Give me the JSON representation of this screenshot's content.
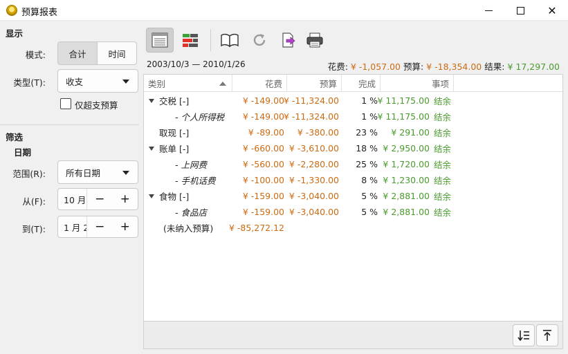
{
  "window": {
    "title": "预算报表"
  },
  "display": {
    "section_label": "显示",
    "mode_label": "模式:",
    "mode_options": [
      "合计",
      "时间"
    ],
    "type_label": "类型(T):",
    "type_value": "收支",
    "only_over_label": "仅超支预算"
  },
  "filter": {
    "section_label": "筛选",
    "date_label": "日期",
    "range_label": "范围(R):",
    "range_value": "所有日期",
    "from_label": "从(F):",
    "from_value": "10 月",
    "to_label": "到(T):",
    "to_value": "1 月 2",
    "minus": "−",
    "plus": "+"
  },
  "toolbar": {
    "icons": [
      "table-view-icon",
      "bar-chart-icon",
      "book-icon",
      "refresh-icon",
      "export-icon",
      "print-icon"
    ]
  },
  "report": {
    "date_range": "2003/10/3 — 2010/1/26",
    "spent_label": "花费:",
    "spent_value": "¥ -1,057.00",
    "budget_label": "预算:",
    "budget_value": "¥ -18,354.00",
    "result_label": "结果:",
    "result_value": "¥ 17,297.00"
  },
  "table": {
    "headers": {
      "category": "类别",
      "spent": "花费",
      "budget": "预算",
      "done": "完成",
      "item": "事项"
    },
    "rows": [
      {
        "category": "交税 [-]",
        "spent": "¥ -149.00",
        "budget": "¥ -11,324.00",
        "pct": "1 %",
        "remain": "¥ 11,175.00",
        "item": "结余"
      },
      {
        "category": "- 个人所得税",
        "spent": "¥ -149.00",
        "budget": "¥ -11,324.00",
        "pct": "1 %",
        "remain": "¥ 11,175.00",
        "item": "结余"
      },
      {
        "category": "取现 [-]",
        "spent": "¥ -89.00",
        "budget": "¥ -380.00",
        "pct": "23 %",
        "remain": "¥ 291.00",
        "item": "结余"
      },
      {
        "category": "账单 [-]",
        "spent": "¥ -660.00",
        "budget": "¥ -3,610.00",
        "pct": "18 %",
        "remain": "¥ 2,950.00",
        "item": "结余"
      },
      {
        "category": "- 上网费",
        "spent": "¥ -560.00",
        "budget": "¥ -2,280.00",
        "pct": "25 %",
        "remain": "¥ 1,720.00",
        "item": "结余"
      },
      {
        "category": "- 手机话费",
        "spent": "¥ -100.00",
        "budget": "¥ -1,330.00",
        "pct": "8 %",
        "remain": "¥ 1,230.00",
        "item": "结余"
      },
      {
        "category": "食物 [-]",
        "spent": "¥ -159.00",
        "budget": "¥ -3,040.00",
        "pct": "5 %",
        "remain": "¥ 2,881.00",
        "item": "结余"
      },
      {
        "category": "- 食品店",
        "spent": "¥ -159.00",
        "budget": "¥ -3,040.00",
        "pct": "5 %",
        "remain": "¥ 2,881.00",
        "item": "结余"
      },
      {
        "category": "(未纳入预算)",
        "spent": "¥ -85,272.12",
        "budget": "",
        "pct": "",
        "remain": "",
        "item": ""
      }
    ]
  },
  "colors": {
    "expense": "#cc6b14",
    "positive": "#4a9a2e"
  }
}
